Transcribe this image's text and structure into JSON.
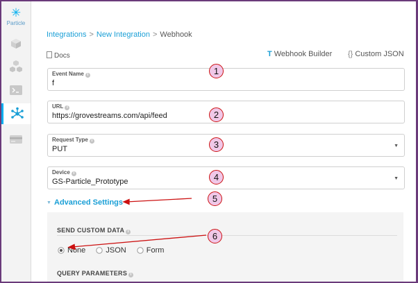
{
  "brand": {
    "logo_text": "Particle"
  },
  "sidebar": {
    "items": [
      {
        "icon": "cube-icon",
        "active": false
      },
      {
        "icon": "cubes-icon",
        "active": false
      },
      {
        "icon": "terminal-icon",
        "active": false
      },
      {
        "icon": "integrations-icon",
        "active": true
      },
      {
        "icon": "billing-card-icon",
        "active": false
      }
    ]
  },
  "breadcrumb": {
    "item1": "Integrations",
    "item2": "New Integration",
    "item3": "Webhook",
    "separator": ">"
  },
  "docs_label": "Docs",
  "tabs": {
    "builder": "Webhook Builder",
    "json": "Custom JSON",
    "json_icon": "{}"
  },
  "fields": {
    "event_name": {
      "label": "Event Name",
      "value": "f"
    },
    "url": {
      "label": "URL",
      "value": "https://grovestreams.com/api/feed"
    },
    "request_type": {
      "label": "Request Type",
      "value": "PUT"
    },
    "device": {
      "label": "Device",
      "value": "GS-Particle_Prototype"
    }
  },
  "advanced": {
    "label": "Advanced Settings"
  },
  "custom_data": {
    "title": "SEND CUSTOM DATA",
    "options": [
      "None",
      "JSON",
      "Form"
    ],
    "selected": "None"
  },
  "query_params": {
    "title": "QUERY PARAMETERS"
  },
  "annotations": {
    "n1": "1",
    "n2": "2",
    "n3": "3",
    "n4": "4",
    "n5": "5",
    "n6": "6"
  },
  "colors": {
    "accent": "#1a9fd6",
    "annotation_red": "#cc1111",
    "annotation_fill": "#f0c8e8"
  }
}
